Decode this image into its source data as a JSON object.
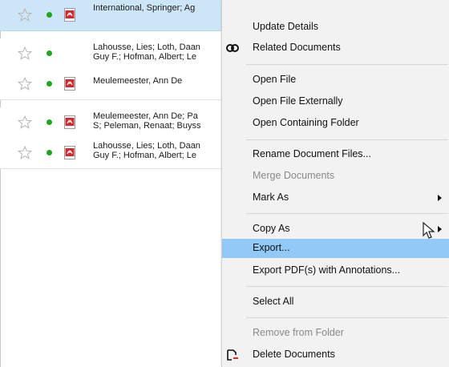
{
  "documents": [
    {
      "authors": "International, Springer; Ag",
      "has_pdf": true,
      "selected": true
    },
    {
      "authors": "Lahousse, Lies; Loth, Daan\nGuy F.; Hofman, Albert; Le",
      "has_pdf": false,
      "selected": false
    },
    {
      "authors": "Meulemeester, Ann De",
      "has_pdf": true,
      "selected": false
    },
    {
      "authors": "Meulemeester, Ann De; Pa\nS; Peleman, Renaat; Buyss",
      "has_pdf": true,
      "selected": false
    },
    {
      "authors": "Lahousse, Lies; Loth, Daan\nGuy F.; Hofman, Albert; Le",
      "has_pdf": true,
      "selected": false
    }
  ],
  "context_menu": {
    "update_details": "Update Details",
    "related_documents": "Related Documents",
    "open_file": "Open File",
    "open_file_externally": "Open File Externally",
    "open_containing_folder": "Open Containing Folder",
    "rename_document_files": "Rename Document Files...",
    "merge_documents": "Merge Documents",
    "mark_as": "Mark As",
    "copy_as": "Copy As",
    "export": "Export...",
    "export_pdf_annotations": "Export PDF(s) with Annotations...",
    "select_all": "Select All",
    "remove_from_folder": "Remove from Folder",
    "delete_documents": "Delete Documents"
  },
  "colors": {
    "selected_row": "#cde6f7",
    "menu_highlight": "#91c9f7",
    "read_dot": "#1fa51f",
    "pdf_red": "#d8262c"
  }
}
